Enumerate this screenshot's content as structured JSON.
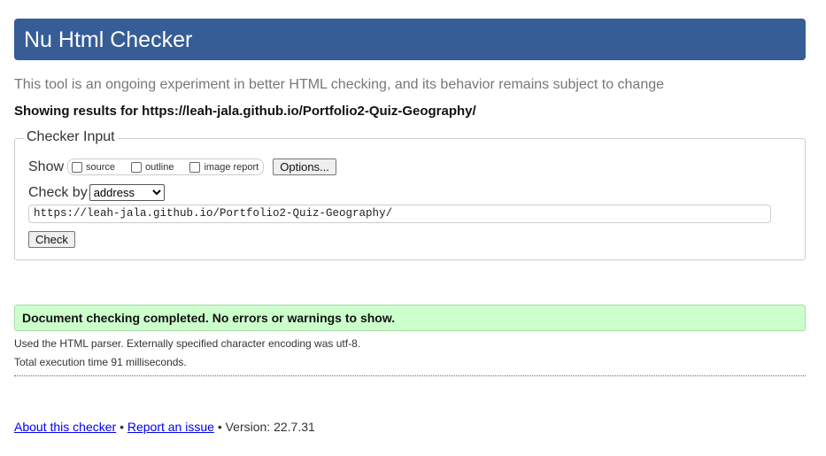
{
  "header": {
    "title": "Nu Html Checker"
  },
  "tagline": "This tool is an ongoing experiment in better HTML checking, and its behavior remains subject to change",
  "showing": "Showing results for https://leah-jala.github.io/Portfolio2-Quiz-Geography/",
  "form": {
    "legend": "Checker Input",
    "show_label": "Show",
    "options": [
      {
        "label": "source",
        "checked": false
      },
      {
        "label": "outline",
        "checked": false
      },
      {
        "label": "image report",
        "checked": false
      }
    ],
    "options_button": "Options...",
    "checkby_label": "Check by",
    "checkby_value": "address",
    "url_value": "https://leah-jala.github.io/Portfolio2-Quiz-Geography/",
    "check_button": "Check"
  },
  "result": {
    "success": "Document checking completed. No errors or warnings to show.",
    "parser_info": "Used the HTML parser. Externally specified character encoding was utf-8.",
    "time_info": "Total execution time 91 milliseconds.",
    "success_color": "#ccffcc"
  },
  "footer": {
    "about": "About this checker",
    "sep": "•",
    "report": "Report an issue",
    "version": "• Version: 22.7.31"
  }
}
